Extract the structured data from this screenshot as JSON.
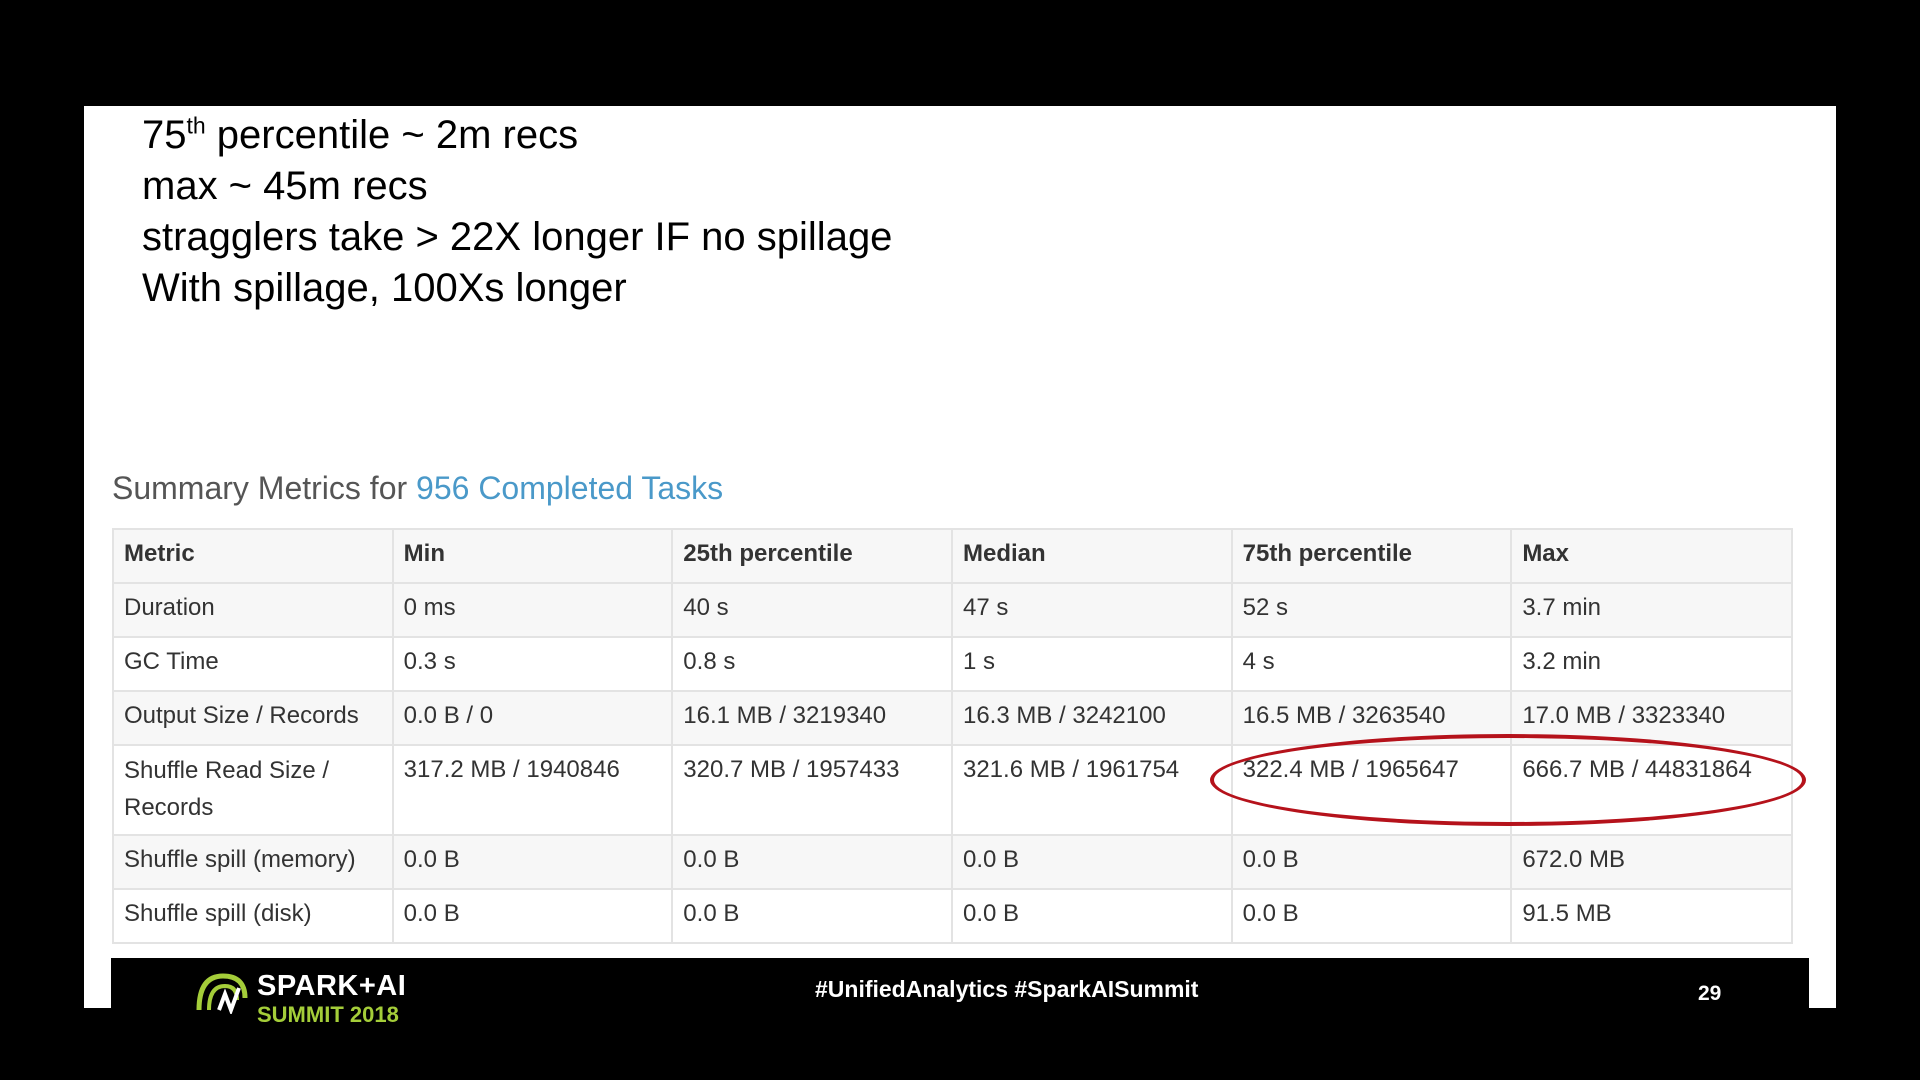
{
  "bullets": {
    "line1_prefix": "75",
    "line1_sup": "th",
    "line1_rest": " percentile ~ 2m recs",
    "line2": "max ~ 45m recs",
    "line3": "stragglers take > 22X longer IF no spillage",
    "line4": "With spillage, 100Xs longer"
  },
  "summary": {
    "heading_prefix": "Summary Metrics for ",
    "heading_link": "956 Completed Tasks"
  },
  "table": {
    "headers": [
      "Metric",
      "Min",
      "25th percentile",
      "Median",
      "75th percentile",
      "Max"
    ],
    "rows": [
      [
        "Duration",
        "0 ms",
        "40 s",
        "47 s",
        "52 s",
        "3.7 min"
      ],
      [
        "GC Time",
        "0.3 s",
        "0.8 s",
        "1 s",
        "4 s",
        "3.2 min"
      ],
      [
        "Output Size / Records",
        "0.0 B / 0",
        "16.1 MB / 3219340",
        "16.3 MB / 3242100",
        "16.5 MB / 3263540",
        "17.0 MB / 3323340"
      ],
      [
        "Shuffle Read Size / Records",
        "317.2 MB / 1940846",
        "320.7 MB / 1957433",
        "321.6 MB / 1961754",
        "322.4 MB / 1965647",
        "666.7 MB / 44831864"
      ],
      [
        "Shuffle spill (memory)",
        "0.0 B",
        "0.0 B",
        "0.0 B",
        "0.0 B",
        "672.0 MB"
      ],
      [
        "Shuffle spill (disk)",
        "0.0 B",
        "0.0 B",
        "0.0 B",
        "0.0 B",
        "91.5 MB"
      ]
    ]
  },
  "footer": {
    "logo_text": "SPARK+AI",
    "logo_sub": "SUMMIT 2018",
    "hashtags": "#UnifiedAnalytics #SparkAISummit",
    "page_number": "29"
  },
  "colors": {
    "link": "#4a99c9",
    "highlight_ellipse": "#b5121b",
    "logo_accent": "#a4cd39"
  },
  "icons": {
    "logo": "spark-ai-summit-logo"
  }
}
